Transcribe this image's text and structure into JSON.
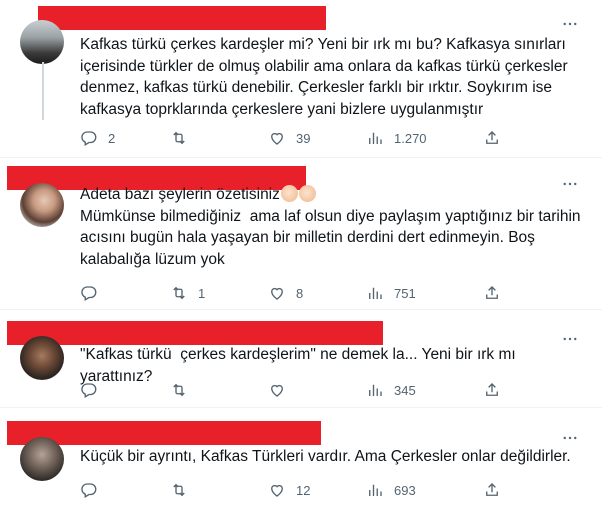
{
  "tweets": [
    {
      "text": "Kafkas türkü çerkes kardeşler mi? Yeni bir ırk mı bu? Kafkasya sınırları içerisinde türkler de olmuş olabilir ama onlara da kafkas türkü çerkesler denmez, kafkas türkü denebilir. Çerkesler farklı bir ırktır. Soykırım ise kafkasya toprklarında çerkeslere yani bizlere uygulanmıştır",
      "replies": "2",
      "retweets": "",
      "likes": "39",
      "views": "1.270"
    },
    {
      "text_line1": "Adeta bazı şeylerin özetisiniz",
      "text_rest": "Mümkünse bilmediğiniz  ama laf olsun diye paylaşım yaptığınız bir tarihin acısını bugün hala yaşayan bir milletin derdini dert edinmeyin. Boş kalabalığa lüzum yok",
      "emoji": "clapping-hands",
      "replies": "",
      "retweets": "1",
      "likes": "8",
      "views": "751"
    },
    {
      "text": "\"Kafkas türkü  çerkes kardeşlerim\" ne demek la... Yeni bir ırk mı yarattınız?",
      "replies": "",
      "retweets": "",
      "likes": "",
      "views": "345"
    },
    {
      "text": "Küçük bir ayrıntı, Kafkas Türkleri vardır. Ama Çerkesler onlar değildirler.",
      "replies": "",
      "retweets": "",
      "likes": "12",
      "views": "693"
    }
  ],
  "icons": {
    "reply": "reply-icon",
    "retweet": "retweet-icon",
    "like": "heart-icon",
    "views": "views-icon",
    "share": "share-icon",
    "more": "more-icon"
  },
  "colors": {
    "redaction": "#e8202a",
    "text": "#0f1419",
    "muted": "#536471",
    "divider": "#eff3f4"
  }
}
